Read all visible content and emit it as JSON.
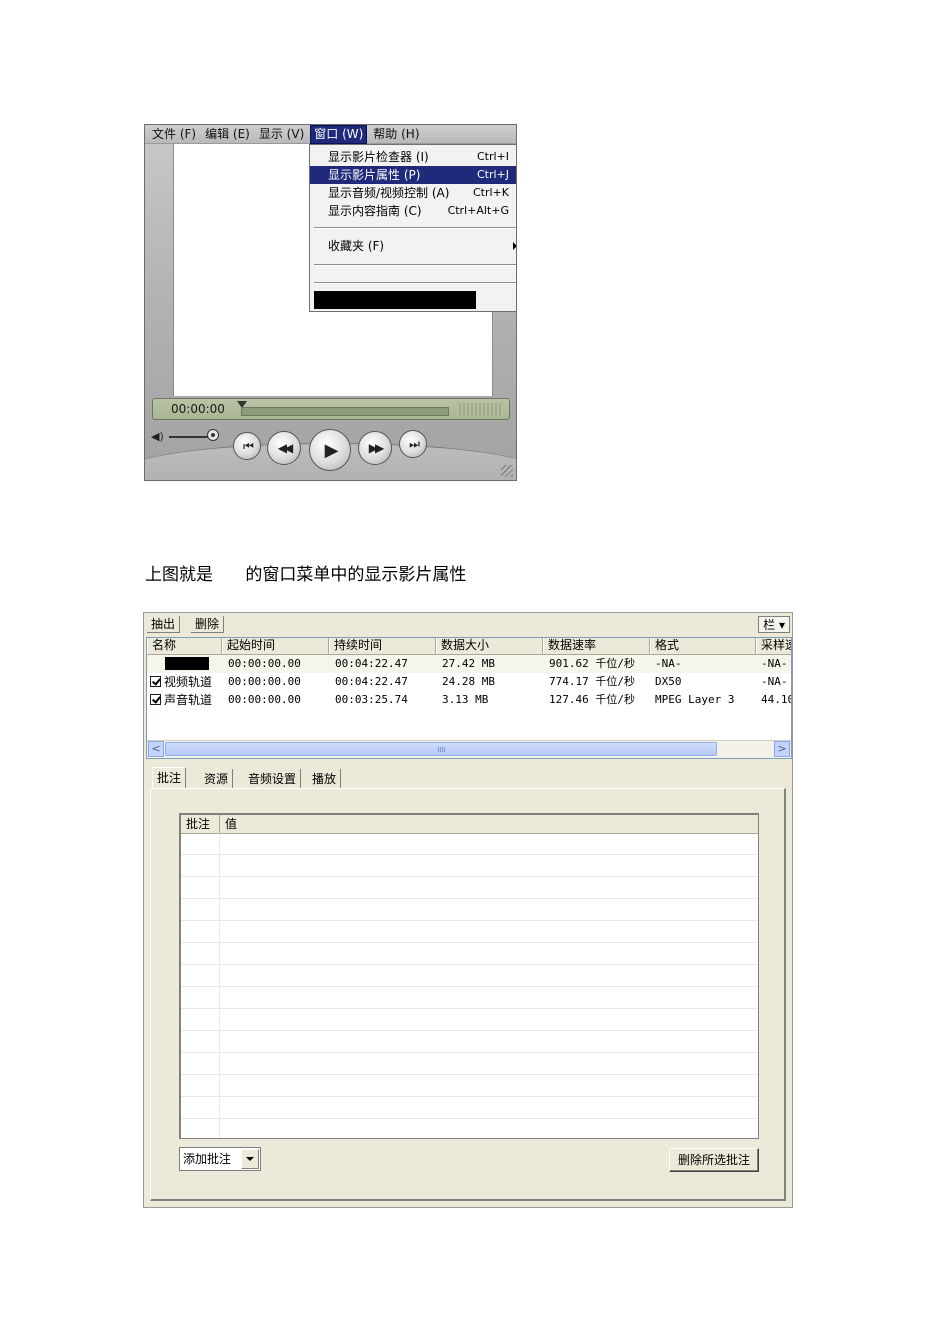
{
  "player": {
    "menubar": [
      "文件 (F)",
      "编辑 (E)",
      "显示 (V)",
      "窗口 (W)",
      "帮助 (H)"
    ],
    "active_menu_index": 3,
    "window_menu": {
      "items": [
        {
          "label": "显示影片检查器 (I)",
          "shortcut": "Ctrl+I"
        },
        {
          "label": "显示影片属性 (P)",
          "shortcut": "Ctrl+J",
          "selected": true
        },
        {
          "label": "显示音频/视频控制 (A)",
          "shortcut": "Ctrl+K"
        },
        {
          "label": "显示内容指南 (C)",
          "shortcut": "Ctrl+Alt+G"
        }
      ],
      "favorites": "收藏夹 (F)"
    },
    "time": "00:00:00",
    "controls": {
      "to_start": "⏮",
      "rewind": "◀◀",
      "play": "▶",
      "fast_forward": "▶▶",
      "to_end": "⏭",
      "volume": "◀)"
    }
  },
  "caption": "上图就是      的窗口菜单中的显示影片属性",
  "properties": {
    "toolbar": {
      "extract": "抽出",
      "delete": "删除",
      "columns": "栏 ▾"
    },
    "columns": [
      "名称",
      "起始时间",
      "持续时间",
      "数据大小",
      "数据速率",
      "格式",
      "采样速率"
    ],
    "tracks": [
      {
        "name": "",
        "checked": false,
        "start": "00:00:00.00",
        "duration": "00:04:22.47",
        "size": "27.42 MB",
        "rate": "901.62 千位/秒",
        "format": "-NA-",
        "sample": "-NA-"
      },
      {
        "name": "视频轨道",
        "checked": true,
        "start": "00:00:00.00",
        "duration": "00:04:22.47",
        "size": "24.28 MB",
        "rate": "774.17 千位/秒",
        "format": "DX50",
        "sample": "-NA-"
      },
      {
        "name": "声音轨道",
        "checked": true,
        "start": "00:00:00.00",
        "duration": "00:03:25.74",
        "size": "3.13 MB",
        "rate": "127.46 千位/秒",
        "format": "MPEG Layer 3",
        "sample": "44.10"
      }
    ],
    "scroll": {
      "left": "<",
      "right": ">"
    },
    "tabs": [
      "批注",
      "资源",
      "音频设置",
      "播放"
    ],
    "active_tab": 0,
    "annotation_columns": [
      "批注",
      "值"
    ],
    "add_annotation": "添加批注",
    "delete_selected": "删除所选批注"
  }
}
